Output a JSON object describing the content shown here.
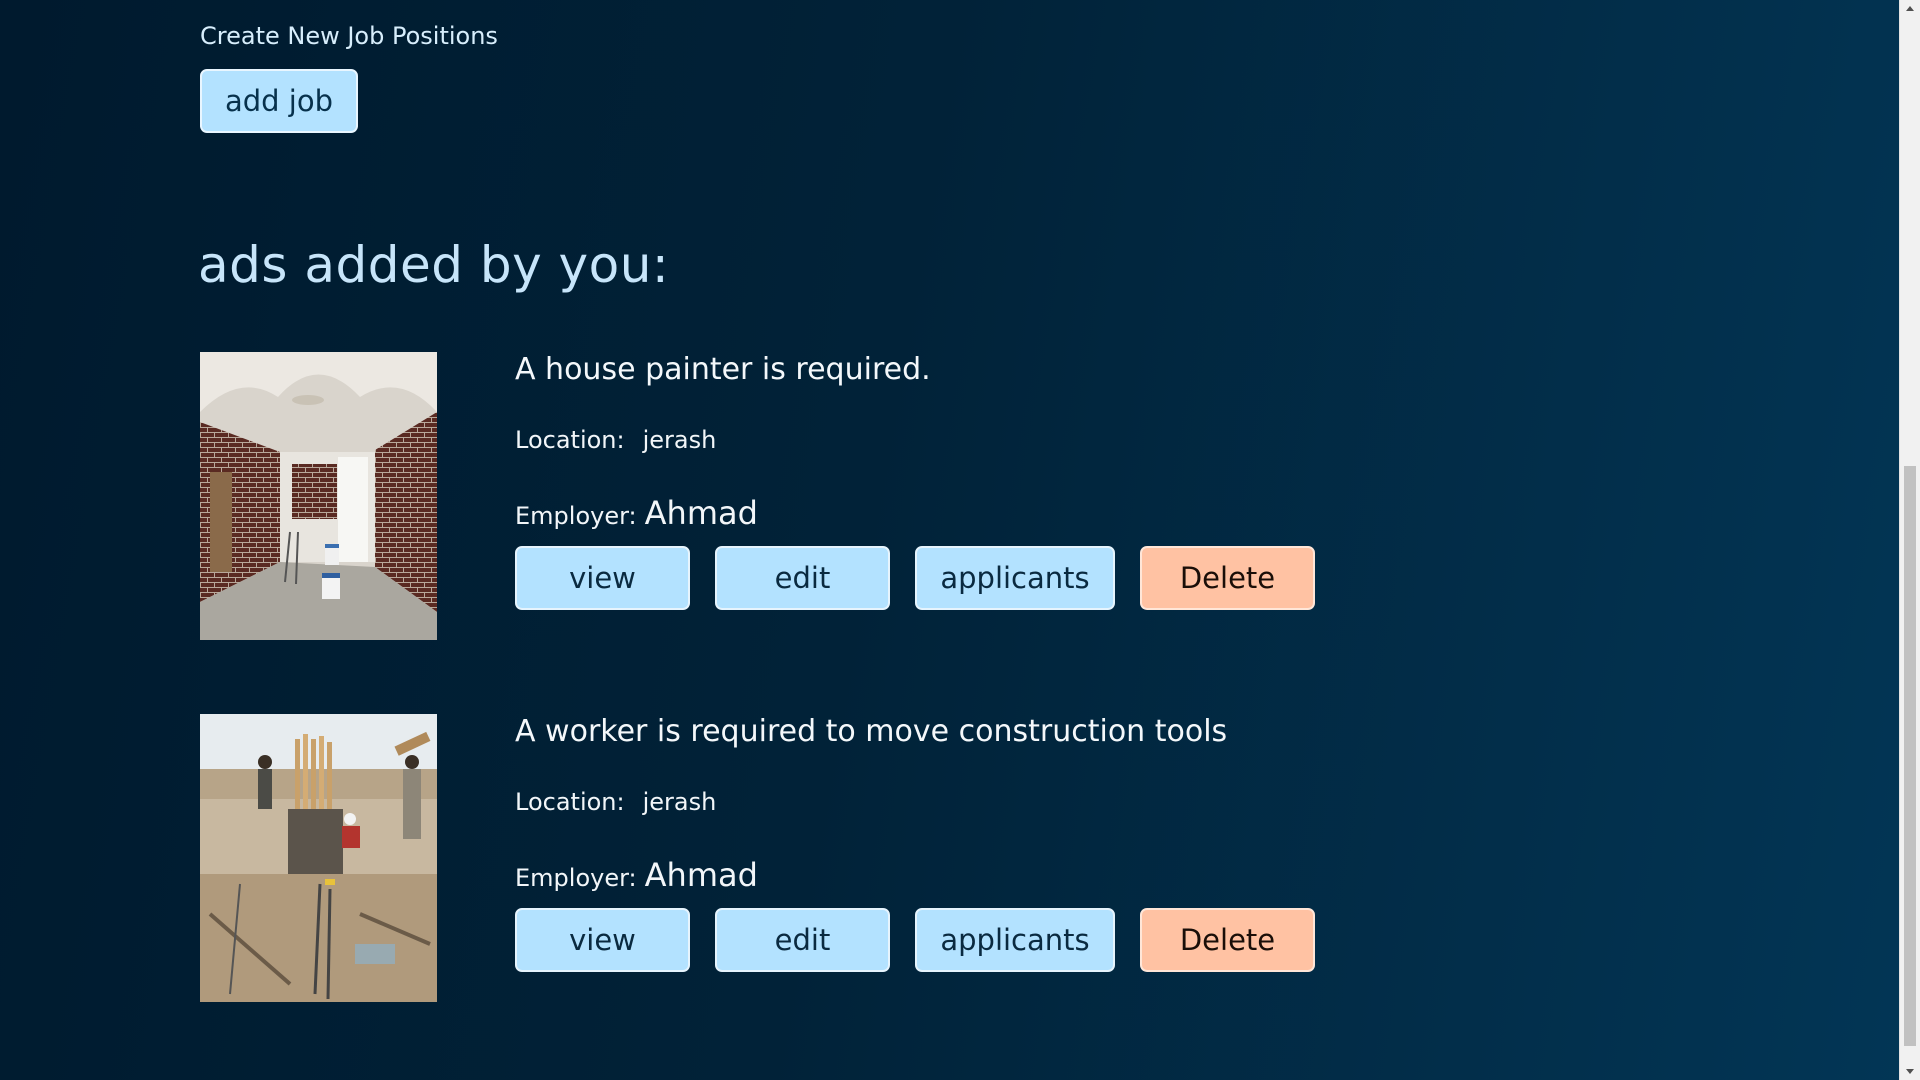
{
  "header": {
    "create_label": "Create New Job Positions",
    "add_job_label": "add job"
  },
  "section": {
    "heading": "ads added by you:"
  },
  "ads": [
    {
      "title": "A house painter is required.",
      "location_label": "Location:",
      "location": "jerash",
      "employer_label": "Employer:",
      "employer": "Ahmad",
      "buttons": {
        "view": "view",
        "edit": "edit",
        "applicants": "applicants",
        "delete": "Delete"
      }
    },
    {
      "title": "A worker is required to move construction tools",
      "location_label": "Location:",
      "location": "jerash",
      "employer_label": "Employer:",
      "employer": "Ahmad",
      "buttons": {
        "view": "view",
        "edit": "edit",
        "applicants": "applicants",
        "delete": "Delete"
      }
    }
  ],
  "colors": {
    "background": "#012238",
    "primary_button": "#b3e2ff",
    "danger_button": "#ffc2a3",
    "heading": "#c7e5fa"
  },
  "icons": {
    "scroll_up": "triangle-up-icon",
    "scroll_down": "triangle-down-icon"
  }
}
